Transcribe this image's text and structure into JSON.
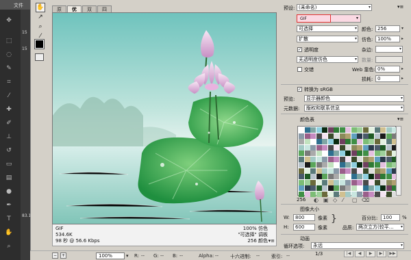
{
  "ps": {
    "menu_label": "文件",
    "side_numbers": [
      "15",
      "15",
      "83.1"
    ]
  },
  "dialog": {
    "tabs": [
      "原稿",
      "优化",
      "双联",
      "四联"
    ],
    "active_tab": "优化",
    "image_info": {
      "format": "GIF",
      "size": "534.6K",
      "time": "98 秒 @ 56.6 Kbps",
      "dither": "100% 仿色",
      "palette": "\"可选择\" 调板",
      "colors": "256 颜色"
    },
    "statusbar": {
      "zoom": "100%",
      "r": "R:",
      "g": "G:",
      "b": "B:",
      "r_val": "--",
      "g_val": "--",
      "b_val": "--",
      "alpha": "Alpha:",
      "alpha_val": "--",
      "hex": "十六进制:",
      "hex_val": "--",
      "index": "索引:",
      "index_val": "--"
    }
  },
  "settings": {
    "preset_label": "预设:",
    "preset_value": "(未命名)",
    "format_value": "GIF",
    "reduction_value": "可选择",
    "colors_label": "颜色:",
    "colors_value": "256",
    "dither_algo_value": "扩散",
    "dither_label": "仿色:",
    "dither_value": "100%",
    "transparency_label": "透明度",
    "matte_label": "杂边:",
    "transparency_dither_value": "无透明度仿色",
    "amount_label": "数量:",
    "interlaced_label": "交错",
    "web_snap_label": "Web 靠色:",
    "web_snap_value": "0%",
    "lossy_label": "损耗:",
    "lossy_value": "0",
    "convert_srgb_label": "转换为 sRGB",
    "preview_label": "预览:",
    "preview_value": "显示器颜色",
    "metadata_label": "元数据:",
    "metadata_value": "版权和联系信息",
    "color_table_label": "颜色表",
    "color_count": "256",
    "image_size_label": "图像大小",
    "w_label": "W:",
    "w_value": "800",
    "h_label": "H:",
    "h_value": "600",
    "px_unit": "像素",
    "percent_label": "百分比:",
    "percent_value": "100",
    "percent_unit": "%",
    "quality_label": "品质:",
    "quality_value": "两次立方(较平…",
    "animation_label": "动画",
    "loop_label": "循环选项:",
    "loop_value": "永远",
    "frame_counter": "1/3"
  },
  "colors": {
    "dialog_bg": "#d4d0c8",
    "highlight_red": "#e03030",
    "format_field_pink": "#fbd9e3"
  }
}
